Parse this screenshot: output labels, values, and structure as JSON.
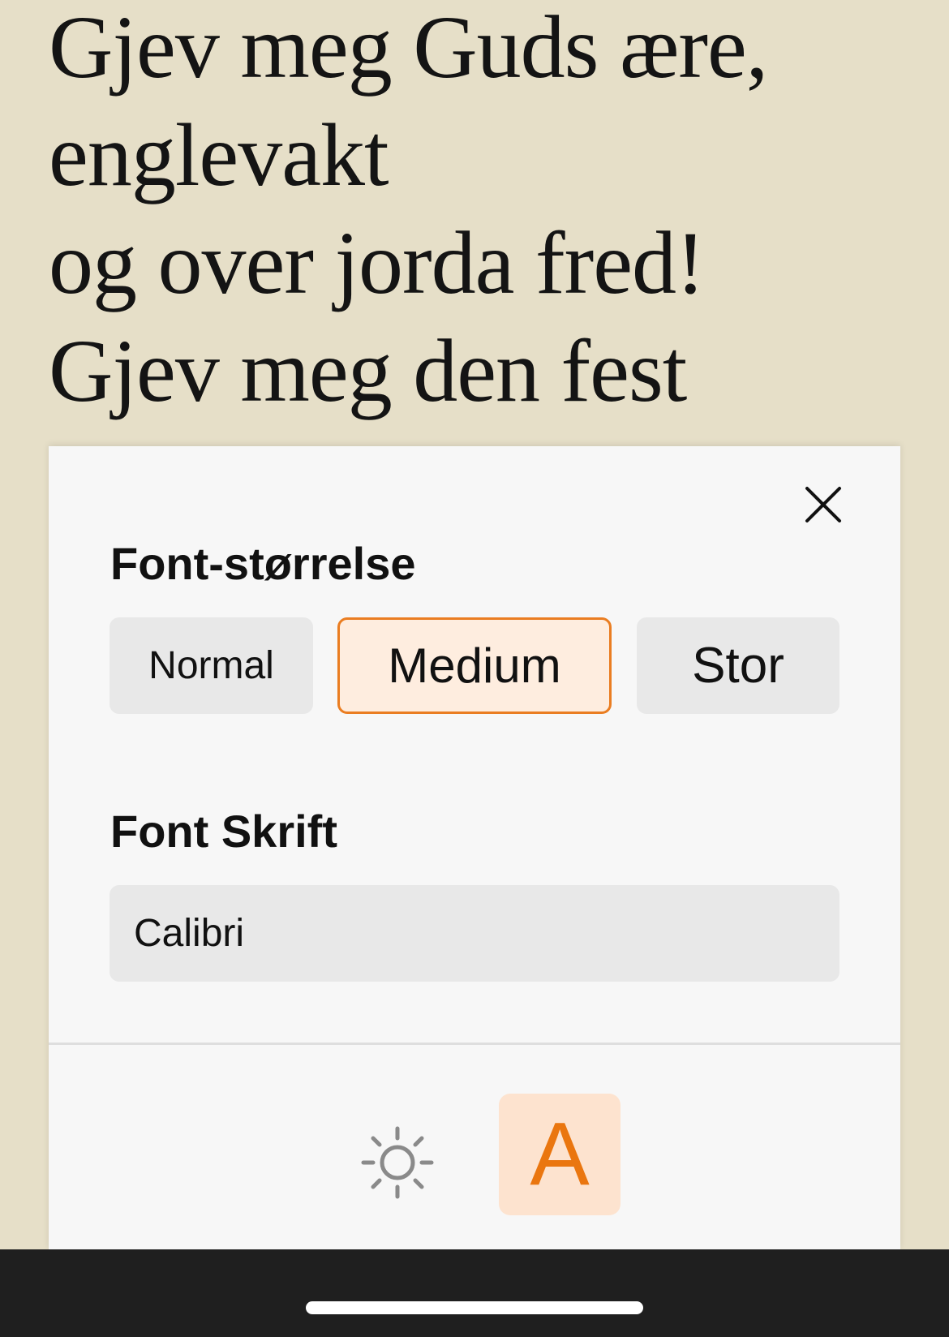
{
  "lyrics": {
    "lines": [
      "Gjev meg Guds ære,",
      "englevakt",
      "og over jorda fred!",
      "Gjev meg den fest"
    ]
  },
  "settings_panel": {
    "close_icon": "close-icon",
    "font_size": {
      "title": "Font-størrelse",
      "options": [
        "Normal",
        "Medium",
        "Stor"
      ],
      "selected": "Medium"
    },
    "font_family": {
      "title": "Font Skrift",
      "value": "Calibri"
    },
    "tabs": [
      {
        "name": "theme",
        "icon": "sun-icon"
      },
      {
        "name": "font",
        "label": "A",
        "active": true
      }
    ]
  },
  "colors": {
    "background": "#e6dfc8",
    "panel": "#f7f7f7",
    "accent": "#ea7d21",
    "accent_fill": "#feeddf",
    "tab_active_bg": "#fde3cf"
  }
}
